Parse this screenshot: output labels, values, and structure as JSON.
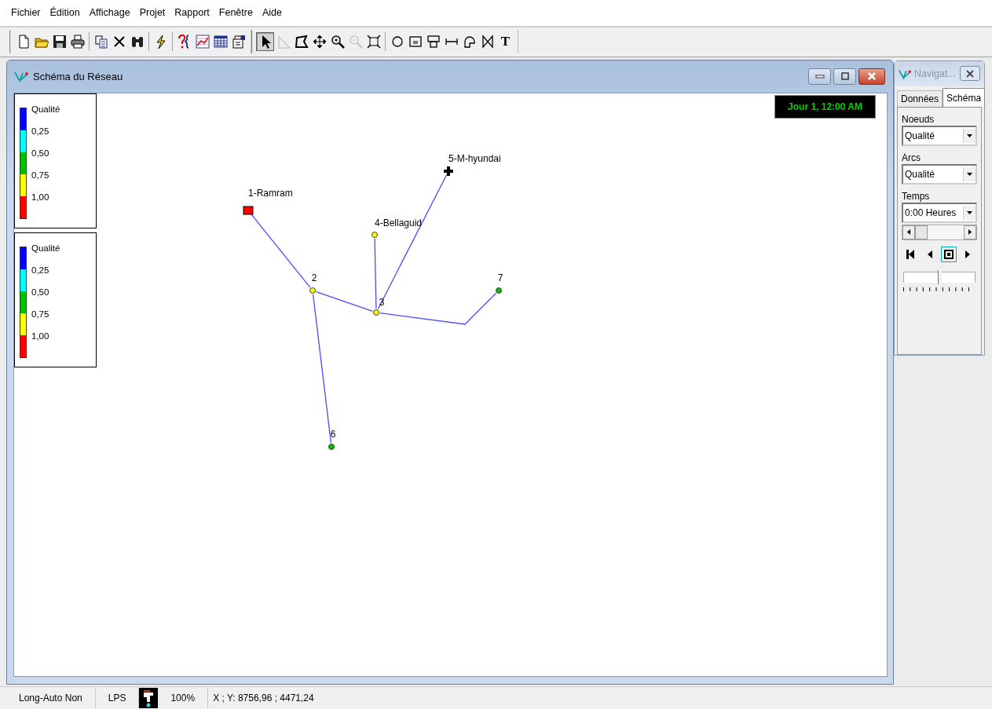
{
  "menu": [
    "Fichier",
    "Édition",
    "Affichage",
    "Projet",
    "Rapport",
    "Fenêtre",
    "Aide"
  ],
  "toolbar": {
    "standard_tools": [
      {
        "kind": "new"
      },
      {
        "kind": "open"
      },
      {
        "kind": "save"
      },
      {
        "kind": "print"
      },
      {
        "kind": "sep"
      },
      {
        "kind": "copy"
      },
      {
        "kind": "delete"
      },
      {
        "kind": "find"
      },
      {
        "kind": "sep"
      },
      {
        "kind": "run"
      },
      {
        "kind": "sep"
      },
      {
        "kind": "query"
      },
      {
        "kind": "graph"
      },
      {
        "kind": "table"
      },
      {
        "kind": "options"
      }
    ],
    "map_tools": [
      {
        "kind": "pointer",
        "selected": true,
        "disabled": false
      },
      {
        "kind": "vertex",
        "selected": false,
        "disabled": true
      },
      {
        "kind": "polygon",
        "selected": false,
        "disabled": false
      },
      {
        "kind": "pan",
        "selected": false,
        "disabled": false
      },
      {
        "kind": "zoomin",
        "selected": false,
        "disabled": false
      },
      {
        "kind": "zoomout",
        "selected": false,
        "disabled": true
      },
      {
        "kind": "extent",
        "selected": false,
        "disabled": false
      }
    ],
    "object_tools": [
      {
        "kind": "junction",
        "selected": false
      },
      {
        "kind": "reservoir",
        "selected": false
      },
      {
        "kind": "tank",
        "selected": false
      },
      {
        "kind": "pipe",
        "selected": false
      },
      {
        "kind": "pump",
        "selected": false
      },
      {
        "kind": "valve",
        "selected": false
      },
      {
        "kind": "label",
        "text": "T",
        "selected": false
      }
    ]
  },
  "map_window": {
    "title": "Schéma du Réseau",
    "clock": "Jour 1, 12:00 AM",
    "legends": [
      {
        "title": "Qualité",
        "levels": [
          "0,25",
          "0,50",
          "0,75",
          "1,00"
        ],
        "bands": [
          {
            "color": "#0000ff"
          },
          {
            "color": "#00ffff"
          },
          {
            "color": "#00c000"
          },
          {
            "color": "#ffff00"
          },
          {
            "color": "#ff0000"
          }
        ]
      },
      {
        "title": "Qualité",
        "levels": [
          "0,25",
          "0,50",
          "0,75",
          "1,00"
        ],
        "bands": [
          {
            "color": "#0000ff"
          },
          {
            "color": "#00ffff"
          },
          {
            "color": "#00c000"
          },
          {
            "color": "#ffff00"
          },
          {
            "color": "#ff0000"
          }
        ]
      }
    ],
    "nodes": [
      {
        "label": "1-Ramram",
        "kind": "tank",
        "color": "#ff0000"
      },
      {
        "label": "2",
        "kind": "junction",
        "color": "#ffff00"
      },
      {
        "label": "3",
        "kind": "junction",
        "color": "#ffff00"
      },
      {
        "label": "4-Bellaguid",
        "kind": "junction",
        "color": "#ffff00"
      },
      {
        "label": "5-M-hyundai",
        "kind": "reservoir",
        "color": "#000000"
      },
      {
        "label": "6",
        "kind": "junction",
        "color": "#00c000"
      },
      {
        "label": "7",
        "kind": "junction",
        "color": "#00c000"
      }
    ]
  },
  "navigator": {
    "title": "Navigat...",
    "tabs": [
      {
        "label": "Données",
        "selected": false
      },
      {
        "label": "Schéma",
        "selected": true
      }
    ],
    "fields": [
      {
        "label": "Noeuds",
        "value": "Qualité"
      },
      {
        "label": "Arcs",
        "value": "Qualité"
      },
      {
        "label": "Temps",
        "value": "0:00 Heures"
      }
    ],
    "playback": [
      {
        "kind": "rewind",
        "selected": false
      },
      {
        "kind": "back",
        "selected": false
      },
      {
        "kind": "stop",
        "selected": true
      },
      {
        "kind": "forward",
        "selected": false
      }
    ],
    "speed": {
      "level": 0.5
    }
  },
  "status_bar": {
    "autolength": "Long-Auto Non",
    "units": "LPS",
    "zoom": "100%",
    "coordinates": "X ; Y: 8756,96 ;  4471,24"
  }
}
